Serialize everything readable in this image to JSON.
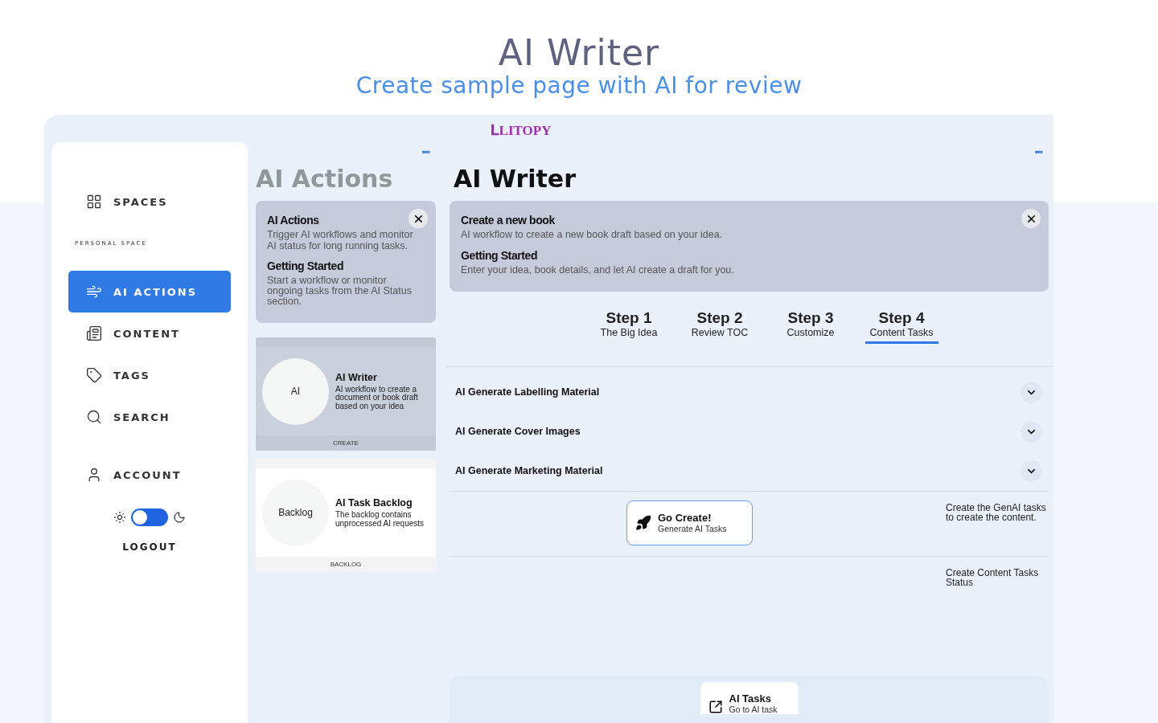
{
  "header": {
    "title": "AI Writer",
    "subtitle": "Create sample page with AI for review"
  },
  "logo": {
    "mark": "𝐋",
    "text": "LITOPY"
  },
  "sidebar": {
    "items": [
      {
        "kind": "spaces",
        "label": "SPACES",
        "selected": false
      },
      {
        "kind": "section",
        "label": "PERSONAL SPACE"
      },
      {
        "kind": "ai",
        "label": "AI ACTIONS",
        "selected": true
      },
      {
        "kind": "content",
        "label": "CONTENT",
        "selected": false
      },
      {
        "kind": "tags",
        "label": "TAGS",
        "selected": false
      },
      {
        "kind": "search",
        "label": "SEARCH",
        "selected": false
      },
      {
        "kind": "account",
        "label": "ACCOUNT",
        "selected": false
      }
    ],
    "theme_toggle": {
      "on": false
    },
    "logout": "LOGOUT"
  },
  "actions_panel": {
    "menu": "•••",
    "title": "AI Actions",
    "info": {
      "title": "AI Actions",
      "text": "Trigger AI workflows and monitor AI status for long running tasks.",
      "subtitle": "Getting Started",
      "subtext": "Start a workflow or monitor ongoing tasks from the AI Status section."
    },
    "cards": [
      {
        "avatar": "AI",
        "title": "AI Writer",
        "text": "AI workflow to create a document or book draft based on your idea",
        "footer": "CREATE",
        "selected": true
      },
      {
        "avatar": "Backlog",
        "title": "AI Task Backlog",
        "text": "The backlog contains unprocessed AI requests",
        "footer": "BACKLOG",
        "selected": false
      }
    ]
  },
  "writer": {
    "menu": "•••",
    "title": "AI Writer",
    "info": {
      "title": "Create a new book",
      "text": "AI workflow to create a new book draft based on your idea.",
      "subtitle": "Getting Started",
      "subtext": "Enter your idea, book details, and let AI create a draft for you."
    },
    "steps": [
      {
        "label": "Step 1",
        "caption": "The Big Idea",
        "selected": false
      },
      {
        "label": "Step 2",
        "caption": "Review TOC",
        "selected": false
      },
      {
        "label": "Step 3",
        "caption": "Customize",
        "selected": false
      },
      {
        "label": "Step 4",
        "caption": "Content Tasks",
        "selected": true
      }
    ],
    "sections": [
      {
        "label": "AI Generate Labelling Material",
        "expanded": false
      },
      {
        "label": "AI Generate Cover Images",
        "expanded": false
      },
      {
        "label": "AI Generate Marketing Material",
        "expanded": false
      }
    ],
    "action_rows": [
      {
        "button": {
          "title": "Go Create!",
          "subtitle": "Generate AI Tasks"
        },
        "note": "Create the GenAI tasks to create the content."
      },
      {
        "note": "Create Content Tasks Status"
      }
    ],
    "tasks_card": {
      "title": "AI Tasks",
      "text": "Go to AI task"
    }
  }
}
